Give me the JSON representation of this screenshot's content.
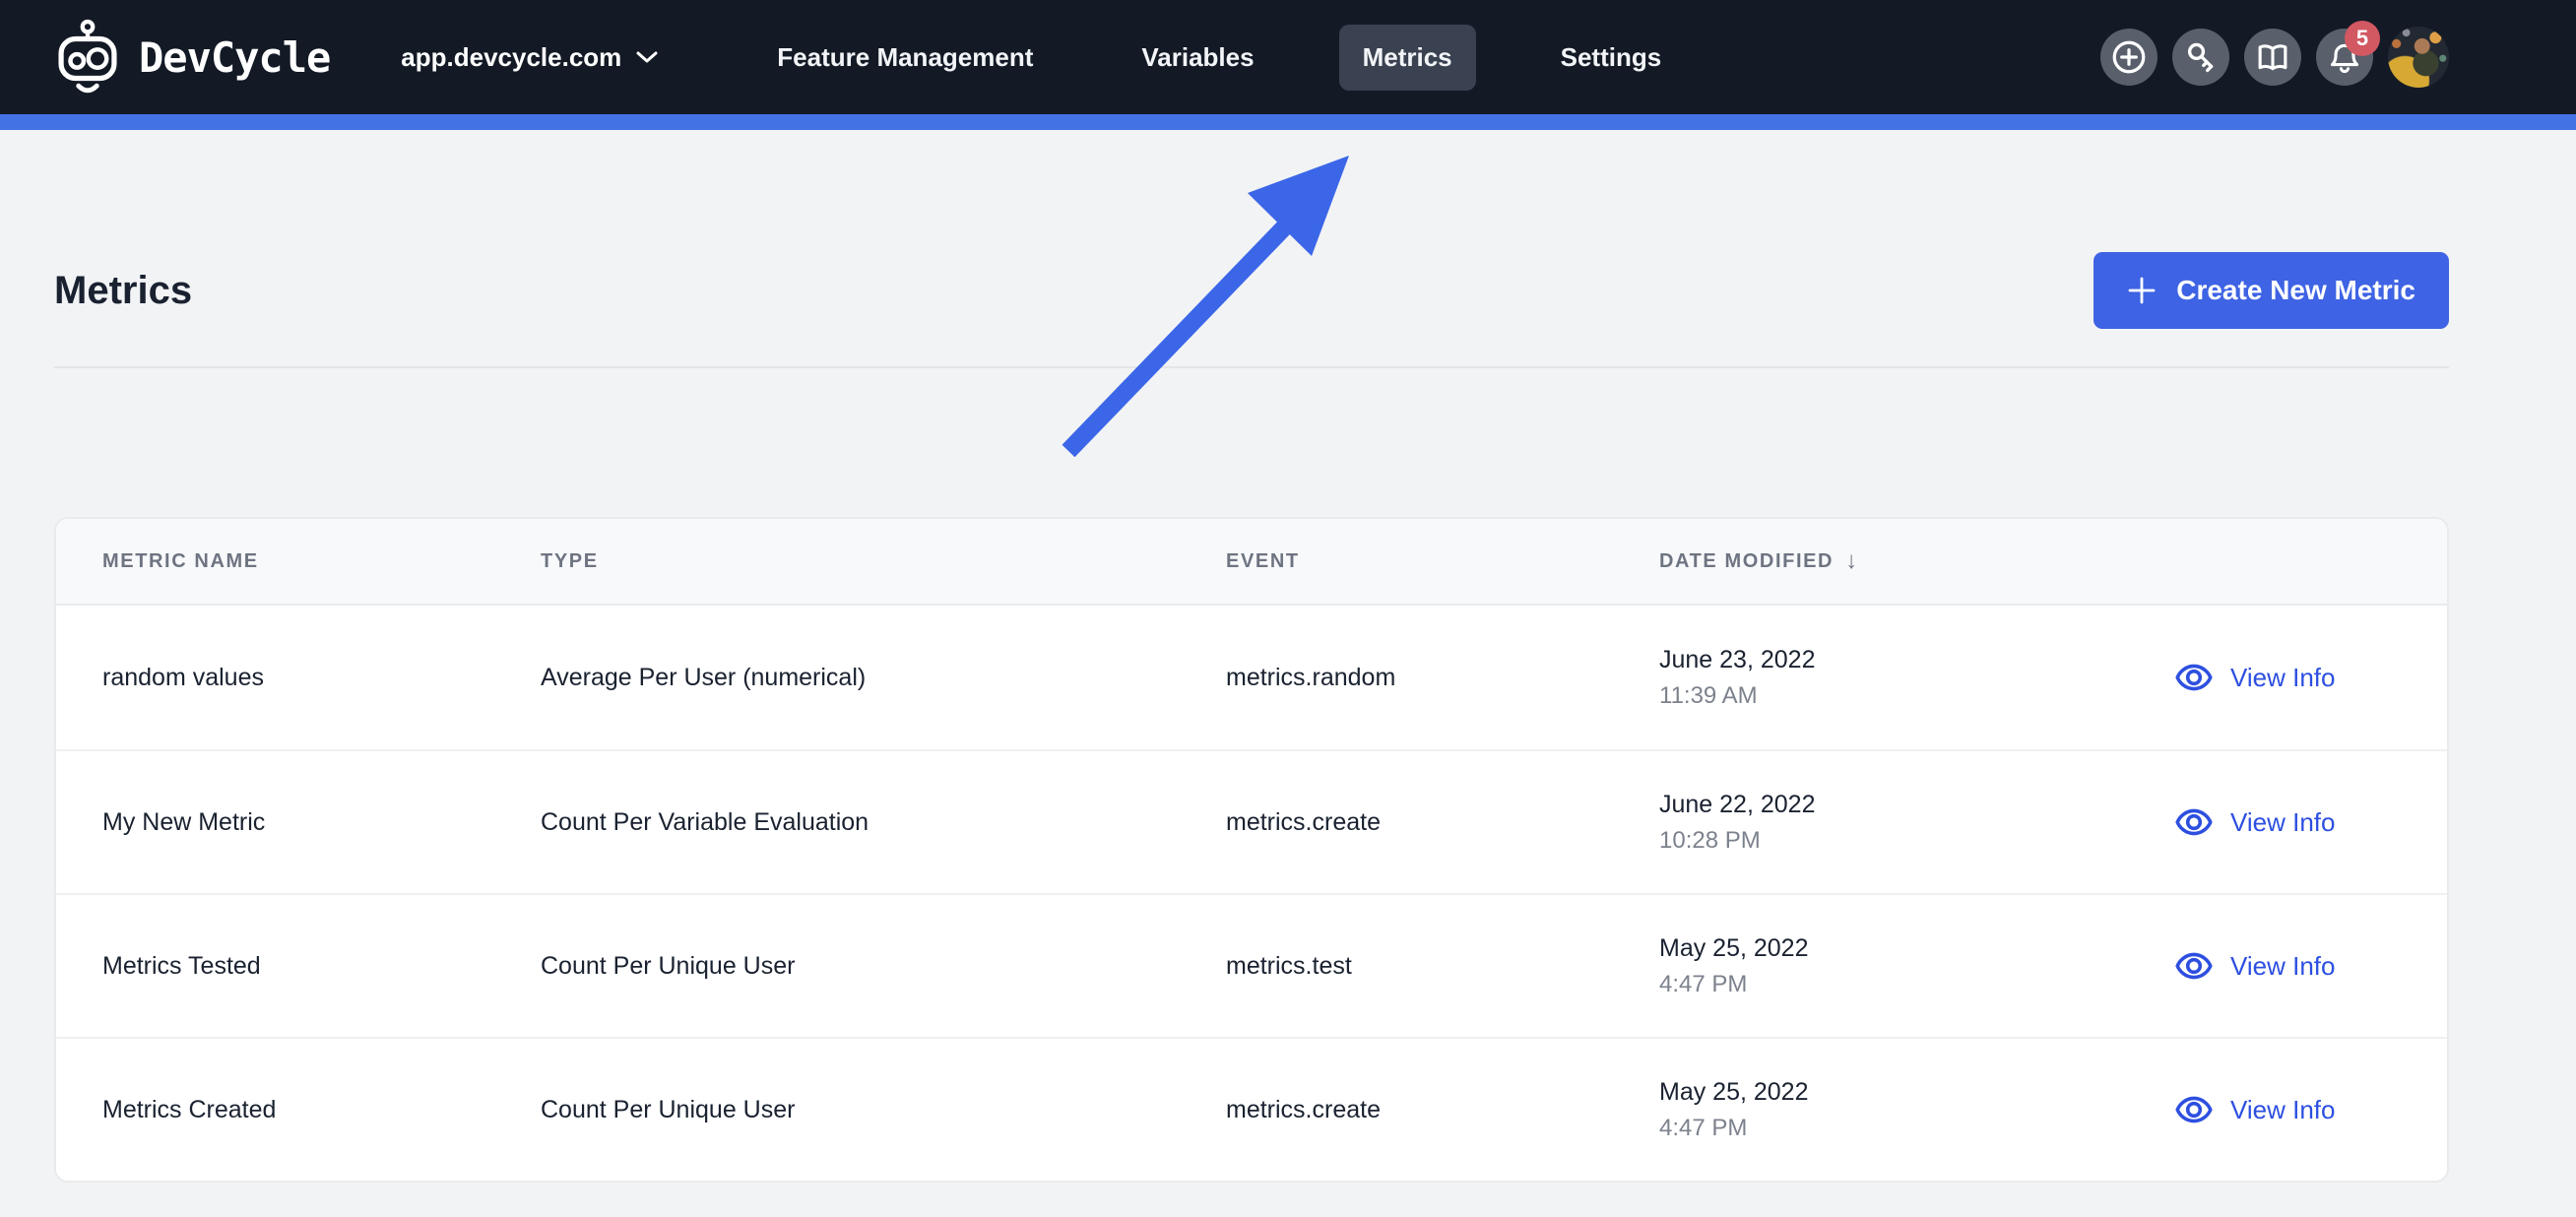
{
  "nav": {
    "logo_text": "DevCycle",
    "org_selector": {
      "label": "app.devcycle.com"
    },
    "items": [
      {
        "label": "Feature Management",
        "active": false
      },
      {
        "label": "Variables",
        "active": false
      },
      {
        "label": "Metrics",
        "active": true
      },
      {
        "label": "Settings",
        "active": false
      }
    ],
    "notification_count": "5",
    "action_icons": [
      "plus-circle-icon",
      "key-icon",
      "book-icon",
      "bell-icon",
      "avatar"
    ]
  },
  "page": {
    "title": "Metrics",
    "create_button_label": "Create New Metric"
  },
  "table": {
    "columns": [
      "Metric Name",
      "Type",
      "Event",
      "Date Modified"
    ],
    "sort_icon": "↓",
    "rows": [
      {
        "name": "random values",
        "type": "Average Per User (numerical)",
        "event": "metrics.random",
        "date": "June 23, 2022",
        "time": "11:39 AM",
        "action": "View Info"
      },
      {
        "name": "My New Metric",
        "type": "Count Per Variable Evaluation",
        "event": "metrics.create",
        "date": "June 22, 2022",
        "time": "10:28 PM",
        "action": "View Info"
      },
      {
        "name": "Metrics Tested",
        "type": "Count Per Unique User",
        "event": "metrics.test",
        "date": "May 25, 2022",
        "time": "4:47 PM",
        "action": "View Info"
      },
      {
        "name": "Metrics Created",
        "type": "Count Per Unique User",
        "event": "metrics.create",
        "date": "May 25, 2022",
        "time": "4:47 PM",
        "action": "View Info"
      }
    ]
  },
  "colors": {
    "nav_bg": "#131a26",
    "accent_bar": "#4372e4",
    "primary_blue": "#3e63e4",
    "link_blue": "#2d4fe0",
    "badge_red": "#d25862",
    "page_bg": "#f2f3f5"
  }
}
